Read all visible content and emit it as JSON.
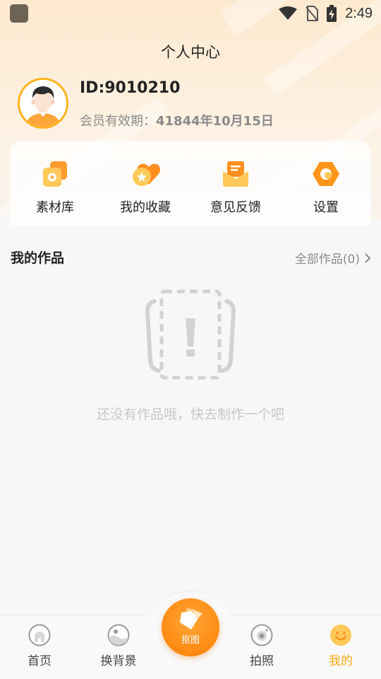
{
  "status_bar": {
    "time": "2:49"
  },
  "page": {
    "title": "个人中心"
  },
  "profile": {
    "id_text": "ID:9010210",
    "membership_label": "会员有效期：",
    "membership_value": "41844年10月15日"
  },
  "quick_actions": [
    {
      "label": "素材库",
      "icon": "material-library-icon"
    },
    {
      "label": "我的收藏",
      "icon": "favorites-icon"
    },
    {
      "label": "意见反馈",
      "icon": "feedback-icon"
    },
    {
      "label": "设置",
      "icon": "settings-icon"
    }
  ],
  "works": {
    "title": "我的作品",
    "all_label": "全部作品(0)",
    "empty_text": "还没有作品哦，快去制作一个吧"
  },
  "bottom_nav": {
    "items": [
      {
        "label": "首页",
        "icon": "home-icon"
      },
      {
        "label": "换背景",
        "icon": "change-background-icon"
      },
      {
        "label": "拍照",
        "icon": "camera-icon"
      },
      {
        "label": "我的",
        "icon": "profile-icon"
      }
    ],
    "center_label": "抠图",
    "active_index": 3
  },
  "colors": {
    "accent": "#ffa60e",
    "fab": "#ff8a12",
    "avatar_border": "#ffb21e",
    "muted_text": "#8a8a8a",
    "empty_text": "#c8c8c8"
  }
}
